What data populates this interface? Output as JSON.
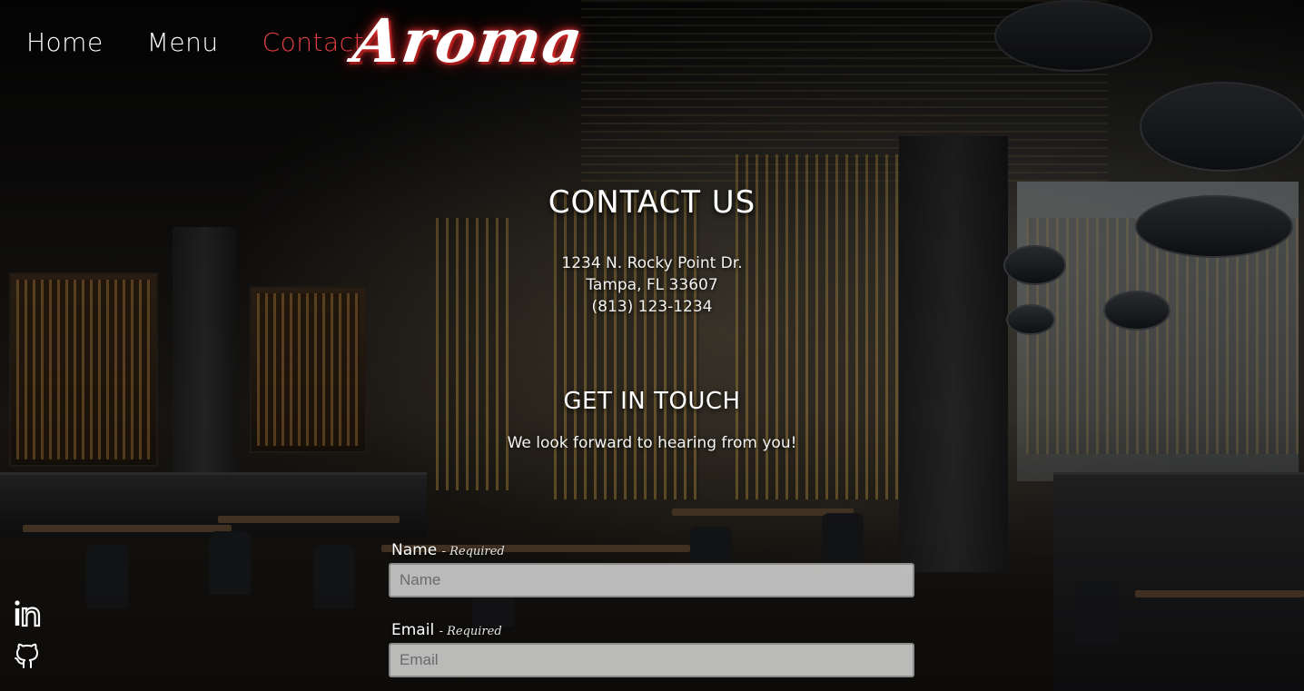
{
  "nav": {
    "items": [
      {
        "label": "Home",
        "active": false
      },
      {
        "label": "Menu",
        "active": false
      },
      {
        "label": "Contact",
        "active": true
      }
    ],
    "logo": "Aroma"
  },
  "contact": {
    "title": "CONTACT US",
    "address_line1": "1234 N. Rocky Point Dr.",
    "address_line2": "Tampa, FL 33607",
    "phone": "(813) 123-1234"
  },
  "touch": {
    "title": "GET IN TOUCH",
    "subtitle": "We look forward to hearing from you!"
  },
  "form": {
    "name": {
      "label": "Name",
      "required": "- Required",
      "placeholder": "Name",
      "value": ""
    },
    "email": {
      "label": "Email",
      "required": "- Required",
      "placeholder": "Email",
      "value": ""
    }
  },
  "social": [
    "linkedin-icon",
    "github-icon"
  ],
  "colors": {
    "accent": "#e03e42",
    "text": "#ffffff"
  }
}
